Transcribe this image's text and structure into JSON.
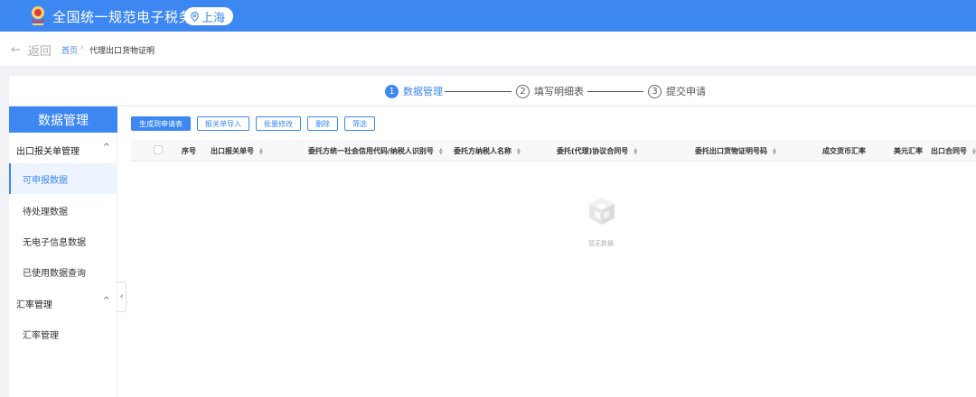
{
  "header": {
    "title": "全国统一规范电子税务局",
    "region": "上海",
    "emblem_icon": "tax-emblem-icon",
    "location_icon": "location-pin-icon",
    "brand_color": "#3d87f3"
  },
  "breadcrumb": {
    "back_label": "返回",
    "home": "首页",
    "separator": "›",
    "current": "代理出口货物证明"
  },
  "steps": [
    {
      "num": "1",
      "label": "数据管理",
      "state": "active"
    },
    {
      "num": "2",
      "label": "填写明细表",
      "state": "todo"
    },
    {
      "num": "3",
      "label": "提交申请",
      "state": "todo"
    }
  ],
  "sidebar": {
    "title": "数据管理",
    "groups": [
      {
        "label": "出口报关单管理",
        "chevron": "^"
      },
      {
        "label": "汇率管理",
        "chevron": "^"
      }
    ],
    "items": [
      {
        "label": "可申报数据",
        "active": true
      },
      {
        "label": "待处理数据"
      },
      {
        "label": "无电子信息数据"
      },
      {
        "label": "已使用数据查询"
      },
      {
        "label": "汇率管理"
      }
    ],
    "collapse_glyph": "‹"
  },
  "toolbar": {
    "generate": "生成到申请表",
    "import": "报关单导入",
    "batch_edit": "批量修改",
    "delete": "删除",
    "filter": "筛选"
  },
  "table": {
    "columns": [
      "序号",
      "出口报关单号",
      "委托方统一社会信用代码/纳税人识别号",
      "委托方纳税人名称",
      "委托(代理)协议合同号",
      "委托出口货物证明号码",
      "成交货币汇率",
      "美元汇率",
      "出口合同号"
    ],
    "empty_text": "暂无数据"
  }
}
